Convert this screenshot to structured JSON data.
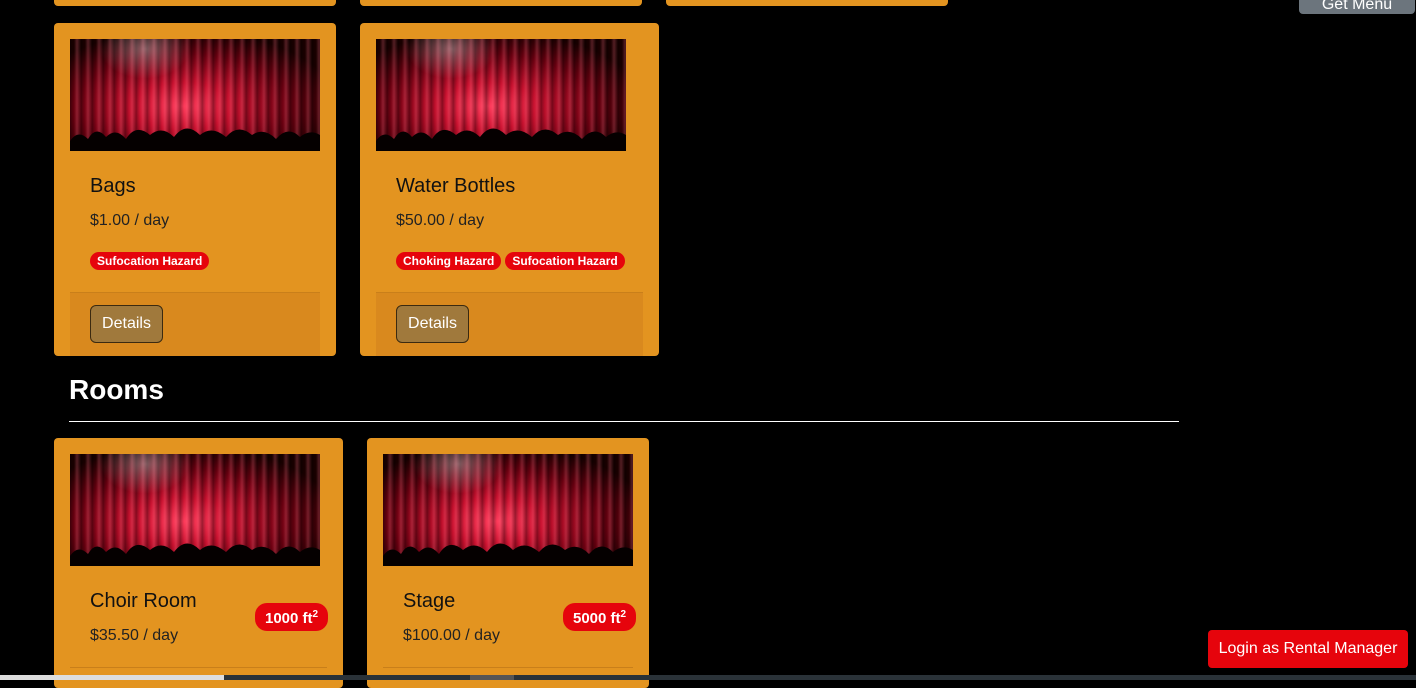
{
  "top_button": {
    "label": "Get Menu"
  },
  "items": [
    {
      "title": "Bags",
      "price": "$1.00 / day",
      "badges": [
        "Sufocation Hazard"
      ],
      "details_label": "Details"
    },
    {
      "title": "Water Bottles",
      "price": "$50.00 / day",
      "badges": [
        "Choking Hazard",
        "Sufocation Hazard"
      ],
      "details_label": "Details"
    }
  ],
  "rooms_section": {
    "title": "Rooms"
  },
  "rooms": [
    {
      "title": "Choir Room",
      "price": "$35.50 / day",
      "size": "1000 ft",
      "size_unit_power": "2"
    },
    {
      "title": "Stage",
      "price": "$100.00 / day",
      "size": "5000 ft",
      "size_unit_power": "2"
    }
  ],
  "login_button": {
    "label": "Login as Rental Manager"
  },
  "colors": {
    "card": "#e39420",
    "badge": "#e6040c",
    "background": "#000000"
  }
}
